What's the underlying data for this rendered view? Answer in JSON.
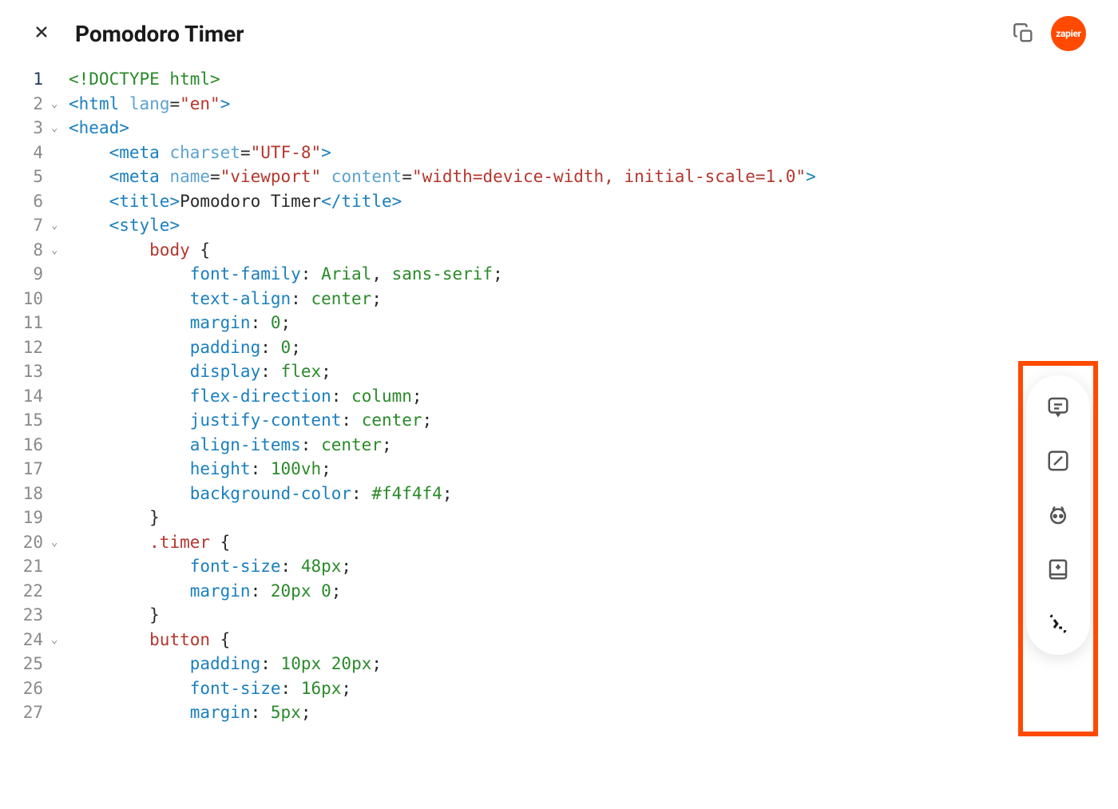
{
  "header": {
    "title": "Pomodoro Timer",
    "logo_text": "zapier"
  },
  "editor": {
    "lines": [
      {
        "num": "1",
        "fold": "",
        "current": true,
        "tokens": [
          {
            "c": "green",
            "t": "<!DOCTYPE html>"
          }
        ]
      },
      {
        "num": "2",
        "fold": "⌄",
        "tokens": [
          {
            "c": "tag-bracket",
            "t": "<"
          },
          {
            "c": "tag-name",
            "t": "html"
          },
          {
            "c": "plain",
            "t": " "
          },
          {
            "c": "attr-name",
            "t": "lang"
          },
          {
            "c": "plain",
            "t": "="
          },
          {
            "c": "attr-value",
            "t": "\"en\""
          },
          {
            "c": "tag-bracket",
            "t": ">"
          }
        ]
      },
      {
        "num": "3",
        "fold": "⌄",
        "tokens": [
          {
            "c": "tag-bracket",
            "t": "<"
          },
          {
            "c": "tag-name",
            "t": "head"
          },
          {
            "c": "tag-bracket",
            "t": ">"
          }
        ]
      },
      {
        "num": "4",
        "fold": "",
        "tokens": [
          {
            "c": "plain",
            "t": "    "
          },
          {
            "c": "tag-bracket",
            "t": "<"
          },
          {
            "c": "tag-name",
            "t": "meta"
          },
          {
            "c": "plain",
            "t": " "
          },
          {
            "c": "attr-name",
            "t": "charset"
          },
          {
            "c": "plain",
            "t": "="
          },
          {
            "c": "attr-value",
            "t": "\"UTF-8\""
          },
          {
            "c": "tag-bracket",
            "t": ">"
          }
        ]
      },
      {
        "num": "5",
        "fold": "",
        "tokens": [
          {
            "c": "plain",
            "t": "    "
          },
          {
            "c": "tag-bracket",
            "t": "<"
          },
          {
            "c": "tag-name",
            "t": "meta"
          },
          {
            "c": "plain",
            "t": " "
          },
          {
            "c": "attr-name",
            "t": "name"
          },
          {
            "c": "plain",
            "t": "="
          },
          {
            "c": "attr-value",
            "t": "\"viewport\""
          },
          {
            "c": "plain",
            "t": " "
          },
          {
            "c": "attr-name",
            "t": "content"
          },
          {
            "c": "plain",
            "t": "="
          },
          {
            "c": "attr-value",
            "t": "\"width=device-width, initial-scale=1.0\""
          },
          {
            "c": "tag-bracket",
            "t": ">"
          }
        ]
      },
      {
        "num": "6",
        "fold": "",
        "tokens": [
          {
            "c": "plain",
            "t": "    "
          },
          {
            "c": "tag-bracket",
            "t": "<"
          },
          {
            "c": "tag-name",
            "t": "title"
          },
          {
            "c": "tag-bracket",
            "t": ">"
          },
          {
            "c": "plain",
            "t": "Pomodoro Timer"
          },
          {
            "c": "tag-bracket",
            "t": "</"
          },
          {
            "c": "tag-name",
            "t": "title"
          },
          {
            "c": "tag-bracket",
            "t": ">"
          }
        ]
      },
      {
        "num": "7",
        "fold": "⌄",
        "tokens": [
          {
            "c": "plain",
            "t": "    "
          },
          {
            "c": "tag-bracket",
            "t": "<"
          },
          {
            "c": "tag-name",
            "t": "style"
          },
          {
            "c": "tag-bracket",
            "t": ">"
          }
        ]
      },
      {
        "num": "8",
        "fold": "⌄",
        "tokens": [
          {
            "c": "plain",
            "t": "        "
          },
          {
            "c": "selector",
            "t": "body"
          },
          {
            "c": "plain",
            "t": " "
          },
          {
            "c": "punct",
            "t": "{"
          }
        ]
      },
      {
        "num": "9",
        "fold": "",
        "tokens": [
          {
            "c": "plain",
            "t": "            "
          },
          {
            "c": "css-prop",
            "t": "font-family"
          },
          {
            "c": "punct",
            "t": ":"
          },
          {
            "c": "plain",
            "t": " "
          },
          {
            "c": "css-value",
            "t": "Arial"
          },
          {
            "c": "punct",
            "t": ","
          },
          {
            "c": "plain",
            "t": " "
          },
          {
            "c": "css-value",
            "t": "sans-serif"
          },
          {
            "c": "punct",
            "t": ";"
          }
        ]
      },
      {
        "num": "10",
        "fold": "",
        "tokens": [
          {
            "c": "plain",
            "t": "            "
          },
          {
            "c": "css-prop",
            "t": "text-align"
          },
          {
            "c": "punct",
            "t": ":"
          },
          {
            "c": "plain",
            "t": " "
          },
          {
            "c": "css-value",
            "t": "center"
          },
          {
            "c": "punct",
            "t": ";"
          }
        ]
      },
      {
        "num": "11",
        "fold": "",
        "tokens": [
          {
            "c": "plain",
            "t": "            "
          },
          {
            "c": "css-prop",
            "t": "margin"
          },
          {
            "c": "punct",
            "t": ":"
          },
          {
            "c": "plain",
            "t": " "
          },
          {
            "c": "css-number",
            "t": "0"
          },
          {
            "c": "punct",
            "t": ";"
          }
        ]
      },
      {
        "num": "12",
        "fold": "",
        "tokens": [
          {
            "c": "plain",
            "t": "            "
          },
          {
            "c": "css-prop",
            "t": "padding"
          },
          {
            "c": "punct",
            "t": ":"
          },
          {
            "c": "plain",
            "t": " "
          },
          {
            "c": "css-number",
            "t": "0"
          },
          {
            "c": "punct",
            "t": ";"
          }
        ]
      },
      {
        "num": "13",
        "fold": "",
        "tokens": [
          {
            "c": "plain",
            "t": "            "
          },
          {
            "c": "css-prop",
            "t": "display"
          },
          {
            "c": "punct",
            "t": ":"
          },
          {
            "c": "plain",
            "t": " "
          },
          {
            "c": "css-value",
            "t": "flex"
          },
          {
            "c": "punct",
            "t": ";"
          }
        ]
      },
      {
        "num": "14",
        "fold": "",
        "tokens": [
          {
            "c": "plain",
            "t": "            "
          },
          {
            "c": "css-prop",
            "t": "flex-direction"
          },
          {
            "c": "punct",
            "t": ":"
          },
          {
            "c": "plain",
            "t": " "
          },
          {
            "c": "css-value",
            "t": "column"
          },
          {
            "c": "punct",
            "t": ";"
          }
        ]
      },
      {
        "num": "15",
        "fold": "",
        "tokens": [
          {
            "c": "plain",
            "t": "            "
          },
          {
            "c": "css-prop",
            "t": "justify-content"
          },
          {
            "c": "punct",
            "t": ":"
          },
          {
            "c": "plain",
            "t": " "
          },
          {
            "c": "css-value",
            "t": "center"
          },
          {
            "c": "punct",
            "t": ";"
          }
        ]
      },
      {
        "num": "16",
        "fold": "",
        "tokens": [
          {
            "c": "plain",
            "t": "            "
          },
          {
            "c": "css-prop",
            "t": "align-items"
          },
          {
            "c": "punct",
            "t": ":"
          },
          {
            "c": "plain",
            "t": " "
          },
          {
            "c": "css-value",
            "t": "center"
          },
          {
            "c": "punct",
            "t": ";"
          }
        ]
      },
      {
        "num": "17",
        "fold": "",
        "tokens": [
          {
            "c": "plain",
            "t": "            "
          },
          {
            "c": "css-prop",
            "t": "height"
          },
          {
            "c": "punct",
            "t": ":"
          },
          {
            "c": "plain",
            "t": " "
          },
          {
            "c": "css-number",
            "t": "100vh"
          },
          {
            "c": "punct",
            "t": ";"
          }
        ]
      },
      {
        "num": "18",
        "fold": "",
        "tokens": [
          {
            "c": "plain",
            "t": "            "
          },
          {
            "c": "css-prop",
            "t": "background-color"
          },
          {
            "c": "punct",
            "t": ":"
          },
          {
            "c": "plain",
            "t": " "
          },
          {
            "c": "css-number",
            "t": "#f4f4f4"
          },
          {
            "c": "punct",
            "t": ";"
          }
        ]
      },
      {
        "num": "19",
        "fold": "",
        "tokens": [
          {
            "c": "plain",
            "t": "        "
          },
          {
            "c": "punct",
            "t": "}"
          }
        ]
      },
      {
        "num": "20",
        "fold": "⌄",
        "tokens": [
          {
            "c": "plain",
            "t": "        "
          },
          {
            "c": "selector",
            "t": ".timer"
          },
          {
            "c": "plain",
            "t": " "
          },
          {
            "c": "punct",
            "t": "{"
          }
        ]
      },
      {
        "num": "21",
        "fold": "",
        "tokens": [
          {
            "c": "plain",
            "t": "            "
          },
          {
            "c": "css-prop",
            "t": "font-size"
          },
          {
            "c": "punct",
            "t": ":"
          },
          {
            "c": "plain",
            "t": " "
          },
          {
            "c": "css-number",
            "t": "48px"
          },
          {
            "c": "punct",
            "t": ";"
          }
        ]
      },
      {
        "num": "22",
        "fold": "",
        "tokens": [
          {
            "c": "plain",
            "t": "            "
          },
          {
            "c": "css-prop",
            "t": "margin"
          },
          {
            "c": "punct",
            "t": ":"
          },
          {
            "c": "plain",
            "t": " "
          },
          {
            "c": "css-number",
            "t": "20px"
          },
          {
            "c": "plain",
            "t": " "
          },
          {
            "c": "css-number",
            "t": "0"
          },
          {
            "c": "punct",
            "t": ";"
          }
        ]
      },
      {
        "num": "23",
        "fold": "",
        "tokens": [
          {
            "c": "plain",
            "t": "        "
          },
          {
            "c": "punct",
            "t": "}"
          }
        ]
      },
      {
        "num": "24",
        "fold": "⌄",
        "tokens": [
          {
            "c": "plain",
            "t": "        "
          },
          {
            "c": "selector",
            "t": "button"
          },
          {
            "c": "plain",
            "t": " "
          },
          {
            "c": "punct",
            "t": "{"
          }
        ]
      },
      {
        "num": "25",
        "fold": "",
        "tokens": [
          {
            "c": "plain",
            "t": "            "
          },
          {
            "c": "css-prop",
            "t": "padding"
          },
          {
            "c": "punct",
            "t": ":"
          },
          {
            "c": "plain",
            "t": " "
          },
          {
            "c": "css-number",
            "t": "10px"
          },
          {
            "c": "plain",
            "t": " "
          },
          {
            "c": "css-number",
            "t": "20px"
          },
          {
            "c": "punct",
            "t": ";"
          }
        ]
      },
      {
        "num": "26",
        "fold": "",
        "tokens": [
          {
            "c": "plain",
            "t": "            "
          },
          {
            "c": "css-prop",
            "t": "font-size"
          },
          {
            "c": "punct",
            "t": ":"
          },
          {
            "c": "plain",
            "t": " "
          },
          {
            "c": "css-number",
            "t": "16px"
          },
          {
            "c": "punct",
            "t": ";"
          }
        ]
      },
      {
        "num": "27",
        "fold": "",
        "tokens": [
          {
            "c": "plain",
            "t": "            "
          },
          {
            "c": "css-prop",
            "t": "margin"
          },
          {
            "c": "punct",
            "t": ":"
          },
          {
            "c": "plain",
            "t": " "
          },
          {
            "c": "css-number",
            "t": "5px"
          },
          {
            "c": "punct",
            "t": ";"
          }
        ]
      }
    ]
  }
}
